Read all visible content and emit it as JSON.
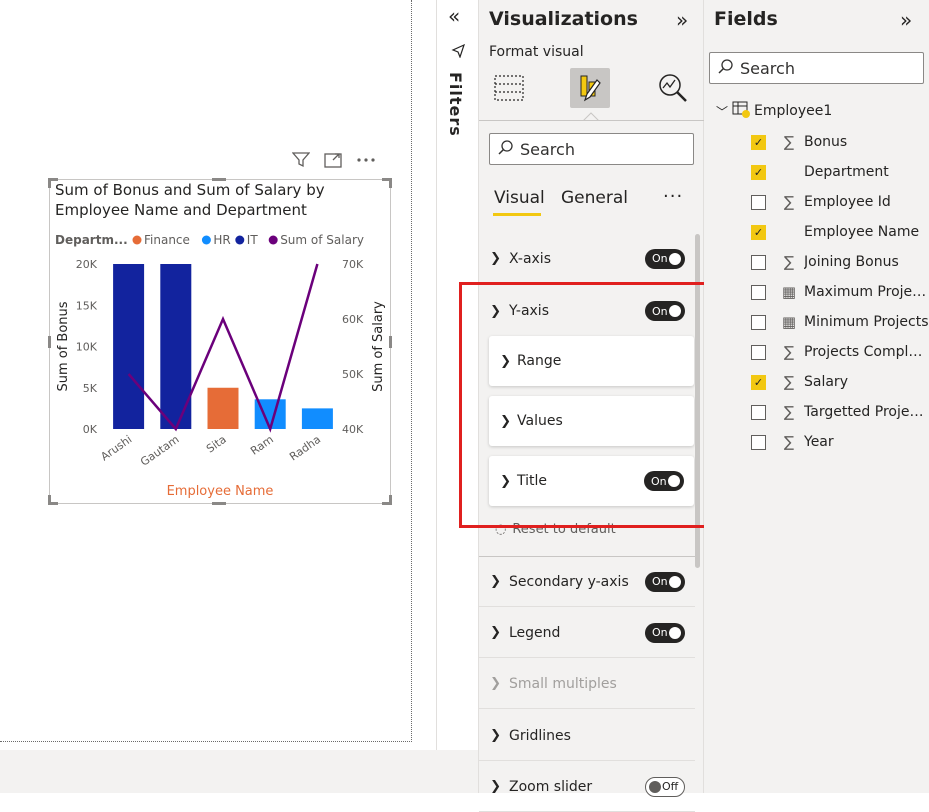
{
  "visual": {
    "title_line1": "Sum of Bonus and Sum of Salary by",
    "title_line2": "Employee Name and Department",
    "legend_label": "Departm...",
    "legend_items": [
      {
        "name": "Finance",
        "color": "#e66c37"
      },
      {
        "name": "HR",
        "color": "#118dff"
      },
      {
        "name": "IT",
        "color": "#12239e"
      },
      {
        "name": "Sum of Salary",
        "color": "#6b007b"
      }
    ],
    "header_icons": [
      "filter-icon",
      "focus-mode-icon",
      "more-options-icon"
    ]
  },
  "chart_data": {
    "type": "bar",
    "categories": [
      "Arushi",
      "Gautam",
      "Sita",
      "Ram",
      "Radha"
    ],
    "series": [
      {
        "name": "Sum of Bonus",
        "values": [
          20000,
          20000,
          5000,
          3600,
          2500
        ],
        "colors": [
          "#12239e",
          "#12239e",
          "#e66c37",
          "#118dff",
          "#118dff"
        ]
      },
      {
        "name": "Sum of Salary",
        "type": "line",
        "axis": "secondary",
        "values": [
          50000,
          40000,
          60000,
          40000,
          70000
        ],
        "color": "#6b007b"
      }
    ],
    "xlabel": "Employee Name",
    "ylabel": "Sum of Bonus",
    "y2label": "Sum of Salary",
    "ylim": [
      0,
      20000
    ],
    "y2lim": [
      40000,
      70000
    ],
    "y_ticks": [
      "0K",
      "5K",
      "10K",
      "15K",
      "20K"
    ],
    "y2_ticks": [
      "40K",
      "50K",
      "60K",
      "70K"
    ],
    "grid": false
  },
  "filters": {
    "label": "Filters"
  },
  "viz_pane": {
    "title": "Visualizations",
    "subtitle": "Format visual",
    "search_placeholder": "Search",
    "tabs": [
      "Visual",
      "General"
    ],
    "sections": [
      {
        "label": "X-axis",
        "toggle": "On"
      },
      {
        "label": "Y-axis",
        "toggle": "On",
        "expanded": true
      },
      {
        "label": "Secondary y-axis",
        "toggle": "On"
      },
      {
        "label": "Legend",
        "toggle": "On"
      },
      {
        "label": "Small multiples",
        "disabled": true
      },
      {
        "label": "Gridlines"
      },
      {
        "label": "Zoom slider",
        "toggle": "Off"
      }
    ],
    "subcards": [
      {
        "label": "Range"
      },
      {
        "label": "Values"
      },
      {
        "label": "Title",
        "toggle": "On"
      }
    ],
    "reset_label": "Reset to default"
  },
  "fields_pane": {
    "title": "Fields",
    "search_placeholder": "Search",
    "table_name": "Employee1",
    "fields": [
      {
        "name": "Bonus",
        "checked": true,
        "icon": "sigma"
      },
      {
        "name": "Department",
        "checked": true,
        "icon": ""
      },
      {
        "name": "Employee Id",
        "checked": false,
        "icon": "sigma"
      },
      {
        "name": "Employee Name",
        "checked": true,
        "icon": ""
      },
      {
        "name": "Joining Bonus",
        "checked": false,
        "icon": "sigma"
      },
      {
        "name": "Maximum Projects",
        "checked": false,
        "icon": "calculator"
      },
      {
        "name": "Minimum Projects",
        "checked": false,
        "icon": "calculator"
      },
      {
        "name": "Projects Complet...",
        "checked": false,
        "icon": "sigma"
      },
      {
        "name": "Salary",
        "checked": true,
        "icon": "sigma"
      },
      {
        "name": "Targetted Projects",
        "checked": false,
        "icon": "sigma"
      },
      {
        "name": "Year",
        "checked": false,
        "icon": "sigma"
      }
    ]
  }
}
